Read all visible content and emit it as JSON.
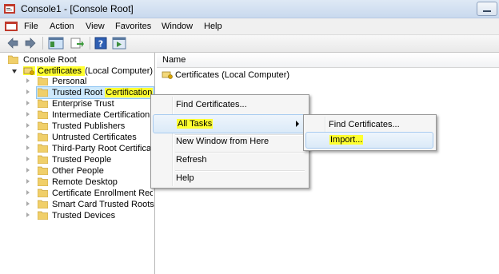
{
  "window": {
    "title": "Console1 - [Console Root]"
  },
  "menubar": {
    "items": [
      "File",
      "Action",
      "View",
      "Favorites",
      "Window",
      "Help"
    ]
  },
  "toolbar": {
    "buttons": [
      "back-arrow-icon",
      "forward-arrow-icon",
      "show-hide-tree-icon",
      "export-list-icon",
      "help-icon",
      "show-action-pane-icon"
    ]
  },
  "tree": {
    "root": "Console Root",
    "certificates": {
      "prefix": "Certificates ",
      "suffix": "(Local Computer)"
    },
    "stores": [
      "Personal",
      "Trusted Root Certification",
      "Enterprise Trust",
      "Intermediate Certification",
      "Trusted Publishers",
      "Untrusted Certificates",
      "Third-Party Root Certificat",
      "Trusted People",
      "Other People",
      "Remote Desktop",
      "Certificate Enrollment Requ",
      "Smart Card Trusted Roots",
      "Trusted Devices"
    ],
    "selected_store": {
      "prefix": "Trusted Root ",
      "highlight": "Certification"
    }
  },
  "right_pane": {
    "column_header": "Name",
    "items": [
      "Certificates (Local Computer)"
    ]
  },
  "context_menu": {
    "items": [
      "Find Certificates...",
      "All Tasks",
      "New Window from Here",
      "Refresh",
      "Help"
    ],
    "hovered": "All Tasks"
  },
  "submenu": {
    "items": [
      "Find Certificates...",
      "Import..."
    ],
    "hovered": "Import..."
  },
  "colors": {
    "highlight": "#ffff2f",
    "selection": "#cde8fc",
    "menu_hover": "#dbeaf8"
  }
}
